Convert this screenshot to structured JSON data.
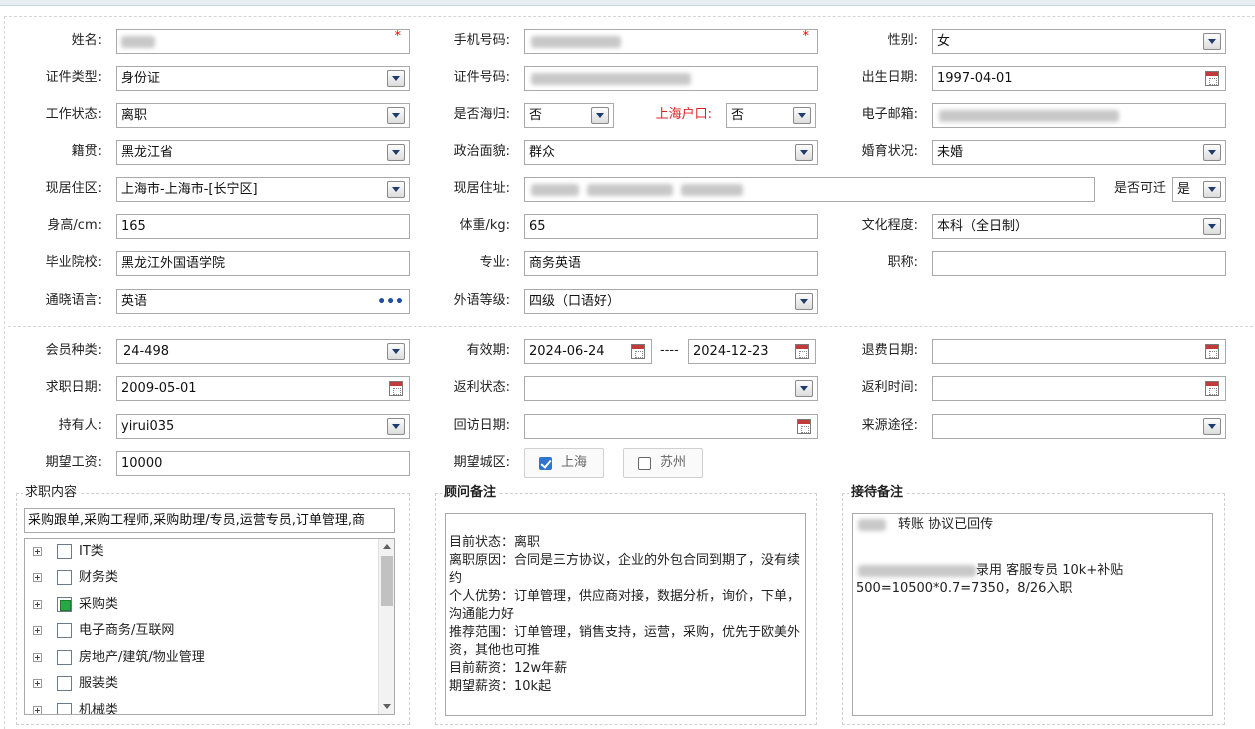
{
  "personal": {
    "name_label": "姓名:",
    "phone_label": "手机号码:",
    "gender_label": "性别:",
    "gender_value": "女",
    "id_type_label": "证件类型:",
    "id_type_value": "身份证",
    "id_no_label": "证件号码:",
    "birth_label": "出生日期:",
    "birth_value": "1997-04-01",
    "work_status_label": "工作状态:",
    "work_status_value": "离职",
    "returnee_label": "是否海归:",
    "returnee_value": "否",
    "hukou_label": "上海户口:",
    "hukou_value": "否",
    "email_label": "电子邮箱:",
    "native_label": "籍贯:",
    "native_value": "黑龙江省",
    "political_label": "政治面貌:",
    "political_value": "群众",
    "marital_label": "婚育状况:",
    "marital_value": "未婚",
    "district_label": "现居住区:",
    "district_value": "上海市-上海市-[长宁区]",
    "address_label": "现居住址:",
    "relocate_label": "是否可迁",
    "relocate_value": "是",
    "height_label": "身高/cm:",
    "height_value": "165",
    "weight_label": "体重/kg:",
    "weight_value": "65",
    "education_label": "文化程度:",
    "education_value": "本科（全日制）",
    "school_label": "毕业院校:",
    "school_value": "黑龙江外国语学院",
    "major_label": "专业:",
    "major_value": "商务英语",
    "title_label": "职称:",
    "title_value": "",
    "language_label": "通晓语言:",
    "language_value": "英语",
    "language_more": "•••",
    "lang_level_label": "外语等级:",
    "lang_level_value": "四级（口语好）",
    "required_mark": "*"
  },
  "membership": {
    "member_type_label": "会员种类:",
    "member_type_value": "24-498",
    "valid_label": "有效期:",
    "valid_from": "2024-06-24",
    "valid_sep": "----",
    "valid_to": "2024-12-23",
    "refund_date_label": "退费日期:",
    "job_date_label": "求职日期:",
    "job_date_value": "2009-05-01",
    "rebate_status_label": "返利状态:",
    "rebate_time_label": "返利时间:",
    "holder_label": "持有人:",
    "holder_value": "yirui035",
    "visit_date_label": "回访日期:",
    "source_label": "来源途径:",
    "salary_label": "期望工资:",
    "salary_value": "10000",
    "city_label": "期望城区:",
    "cities": [
      {
        "name": "上海",
        "checked": true
      },
      {
        "name": "苏州",
        "checked": false
      }
    ]
  },
  "job_content": {
    "title": "求职内容",
    "summary": "采购跟单,采购工程师,采购助理/专员,运营专员,订单管理,商",
    "categories": [
      {
        "label": "IT类",
        "checked": false
      },
      {
        "label": "财务类",
        "checked": false
      },
      {
        "label": "采购类",
        "checked": true
      },
      {
        "label": "电子商务/互联网",
        "checked": false
      },
      {
        "label": "房地产/建筑/物业管理",
        "checked": false
      },
      {
        "label": "服装类",
        "checked": false
      },
      {
        "label": "机械类",
        "checked": false
      }
    ]
  },
  "advisor_notes": {
    "title": "顾问备注",
    "lines": [
      "目前状态：离职",
      "离职原因：合同是三方协议，企业的外包合同到期了，没有续约",
      "个人优势：订单管理，供应商对接，数据分析，询价，下单，沟通能力好",
      "推荐范围：订单管理，销售支持，运营，采购，优先于欧美外资，其他也可推",
      "目前薪资：12w年薪",
      "期望薪资：10k起"
    ]
  },
  "reception_notes": {
    "title": "接待备注",
    "line1": "转账   协议已回传",
    "line2": "录用 客服专员 10k+补贴",
    "line3": "500=10500*0.7=7350，8/26入职"
  }
}
